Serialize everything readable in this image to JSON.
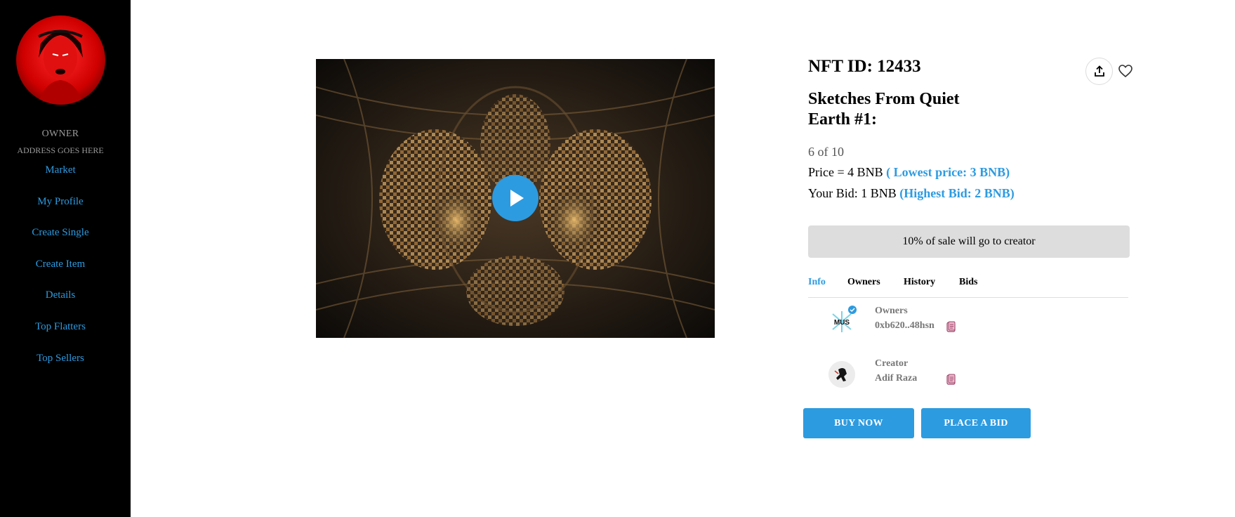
{
  "sidebar": {
    "owner_label": "OWNER",
    "owner_address": "ADDRESS GOES HERE",
    "nav": [
      {
        "label": "Market"
      },
      {
        "label": "My Profile"
      },
      {
        "label": "Create Single"
      },
      {
        "label": "Create Item"
      },
      {
        "label": "Details"
      },
      {
        "label": "Top Flatters"
      },
      {
        "label": "Top Sellers"
      }
    ]
  },
  "nft": {
    "id_text": "NFT ID: 12433",
    "title": "Sketches From Quiet Earth #1:",
    "edition": "6 of 10",
    "price_text": "Price = 4 BNB",
    "lowest_price": "( Lowest price: 3 BNB)",
    "bid_text": "Your Bid: 1 BNB",
    "highest_bid": "(Highest Bid: 2 BNB)",
    "royalty_text": "10% of sale will go to creator"
  },
  "tabs": [
    {
      "label": "Info",
      "active": true
    },
    {
      "label": "Owners",
      "active": false
    },
    {
      "label": "History",
      "active": false
    },
    {
      "label": "Bids",
      "active": false
    }
  ],
  "owner": {
    "role": "Owners",
    "name": "0xb620..48hsn",
    "avatar_text": "MUS"
  },
  "creator": {
    "role": "Creator",
    "name": "Adif Raza"
  },
  "actions": {
    "buy": "BUY NOW",
    "bid": "PLACE A BID"
  },
  "colors": {
    "accent": "#2d9be0",
    "sidebar_bg": "#000000",
    "royalty_bg": "#dddddd"
  },
  "icons": {
    "share": "share-icon",
    "like": "heart-icon",
    "play": "play-icon",
    "copy": "copy-icon"
  }
}
